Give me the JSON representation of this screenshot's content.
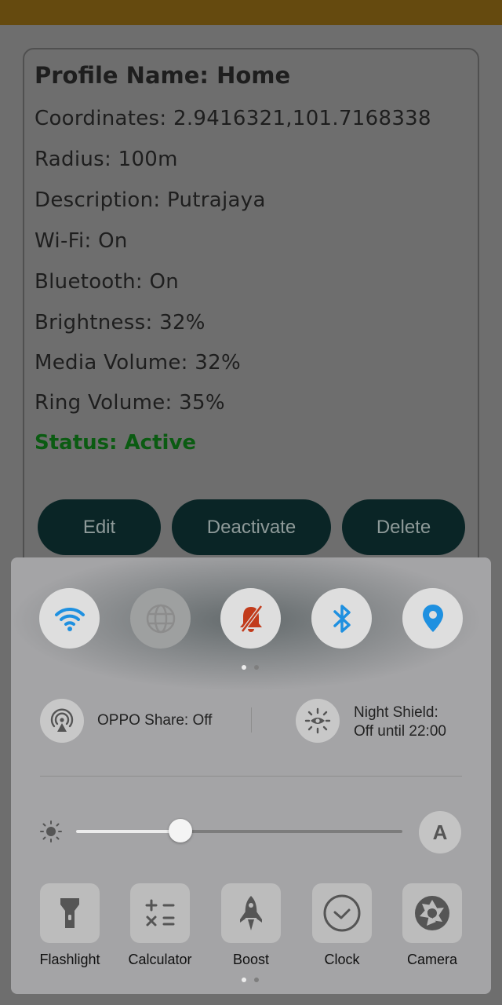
{
  "profile": {
    "title": "Profile Name: Home",
    "coordinates": "Coordinates: 2.9416321,101.7168338",
    "radius": "Radius: 100m",
    "description": "Description: Putrajaya",
    "wifi": "Wi-Fi: On",
    "bluetooth": "Bluetooth: On",
    "brightness": "Brightness: 32%",
    "media_volume": "Media Volume: 32%",
    "ring_volume": "Ring Volume: 35%",
    "status": "Status: Active"
  },
  "actions": {
    "edit": "Edit",
    "deactivate": "Deactivate",
    "delete": "Delete"
  },
  "quick_settings": {
    "toggles": [
      {
        "icon": "wifi-icon",
        "state": "on"
      },
      {
        "icon": "globe-icon",
        "state": "off"
      },
      {
        "icon": "bell-off-icon",
        "state": "on"
      },
      {
        "icon": "bluetooth-icon",
        "state": "on"
      },
      {
        "icon": "location-icon",
        "state": "on"
      }
    ],
    "oppo_share": "OPPO Share: Off",
    "night_shield_line1": "Night Shield:",
    "night_shield_line2": "Off until 22:00",
    "brightness_level": 0.32,
    "auto_label": "A",
    "apps": [
      {
        "label": "Flashlight",
        "icon": "flashlight-icon"
      },
      {
        "label": "Calculator",
        "icon": "calculator-icon"
      },
      {
        "label": "Boost",
        "icon": "rocket-icon"
      },
      {
        "label": "Clock",
        "icon": "clock-icon"
      },
      {
        "label": "Camera",
        "icon": "camera-aperture-icon"
      }
    ]
  },
  "colors": {
    "status_bar": "#654a0f",
    "active_status": "#0b5b12",
    "button_bg": "#0a2526",
    "accent_blue": "#1e90e0",
    "bell_red": "#c23b1b"
  }
}
